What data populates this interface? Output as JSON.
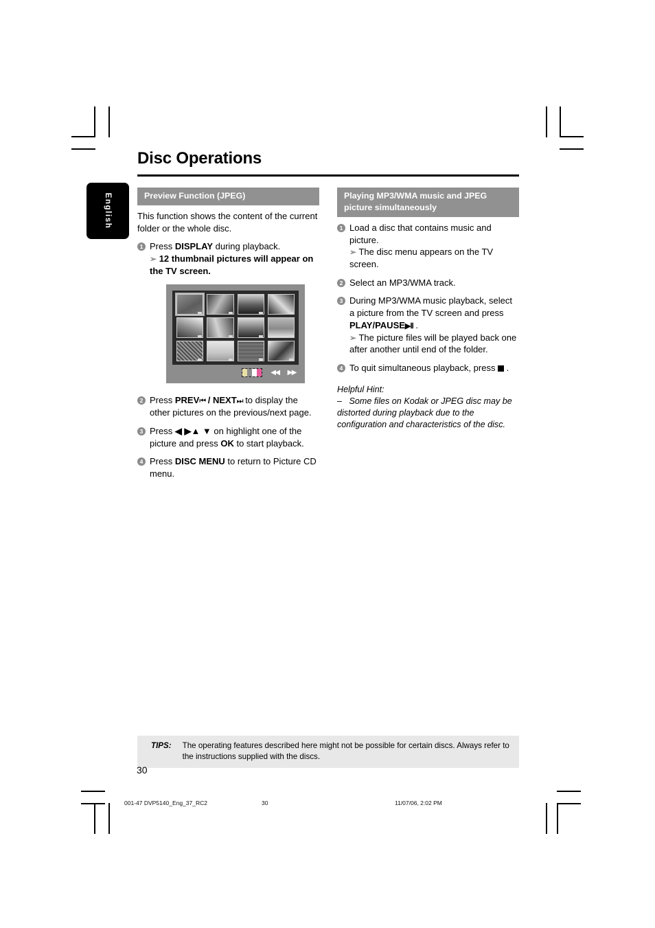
{
  "document": {
    "title": "Disc Operations",
    "language_tab": "English",
    "page_number": "30"
  },
  "left_column": {
    "section_title": "Preview Function (JPEG)",
    "intro": "This function shows the content of the current folder or the whole disc.",
    "steps": [
      {
        "num": "1",
        "text_a": "Press ",
        "bold_a": "DISPLAY",
        "text_b": " during playback.",
        "result": "12 thumbnail pictures will appear on the TV screen."
      },
      {
        "num": "2",
        "text_a": "Press  ",
        "bold_a": "PREV",
        "glyph_a": "⏮",
        "text_b": " / ",
        "bold_b": "NEXT",
        "glyph_b": "⏭",
        "text_c": " to display the other pictures on the previous/next page."
      },
      {
        "num": "3",
        "text_a": "Press ",
        "glyph_a": "◀ ▶▲ ▼",
        "text_b": " on highlight one of the picture and press ",
        "bold_b": "OK",
        "text_c": " to start playback."
      },
      {
        "num": "4",
        "text_a": "Press ",
        "bold_a": "DISC MENU",
        "text_b": " to return to Picture CD menu."
      }
    ],
    "figure": {
      "name": "jpeg-preview-thumbnail-screen",
      "thumbnail_count": 12,
      "selected_index": 0,
      "color_strip": [
        "#e8dfa6",
        "#8d8d8d",
        "#ffffff",
        "#e85b9a"
      ],
      "prev_glyph": "◀◀",
      "next_glyph": "▶▶"
    }
  },
  "right_column": {
    "section_title": "Playing MP3/WMA music and JPEG picture simultaneously",
    "steps": [
      {
        "num": "1",
        "text_a": "Load a disc that contains music and picture.",
        "result": "The disc menu appears on the TV screen."
      },
      {
        "num": "2",
        "text_a": "Select an MP3/WMA track."
      },
      {
        "num": "3",
        "text_a": "During MP3/WMA music playback, select a picture from the TV screen and press ",
        "bold_a": "PLAY/PAUSE",
        "glyph_a": "▶Ⅱ",
        "text_b": " .",
        "result": "The picture files will be played back one after another until end of the folder."
      },
      {
        "num": "4",
        "text_a": "To quit simultaneous playback, press ",
        "glyph_a": "stop-square",
        "text_b": " ."
      }
    ],
    "hint": {
      "title": "Helpful Hint:",
      "dash": "–",
      "body": "Some files on Kodak or JPEG disc may be distorted during playback due to the configuration and characteristics of the disc."
    }
  },
  "footer": {
    "tips_label": "TIPS:",
    "tips_text": "The operating features described here might not be possible for certain discs.  Always refer to the instructions supplied with the discs.",
    "print_file": "001-47 DVP5140_Eng_37_RC2",
    "print_page": "30",
    "print_date": "11/07/06, 2:02 PM"
  },
  "colors": {
    "section_header_bg": "#919191",
    "tips_bg": "#e8e8e8",
    "tab_bg": "#000000",
    "step_num_bg": "#8b8b8b"
  }
}
